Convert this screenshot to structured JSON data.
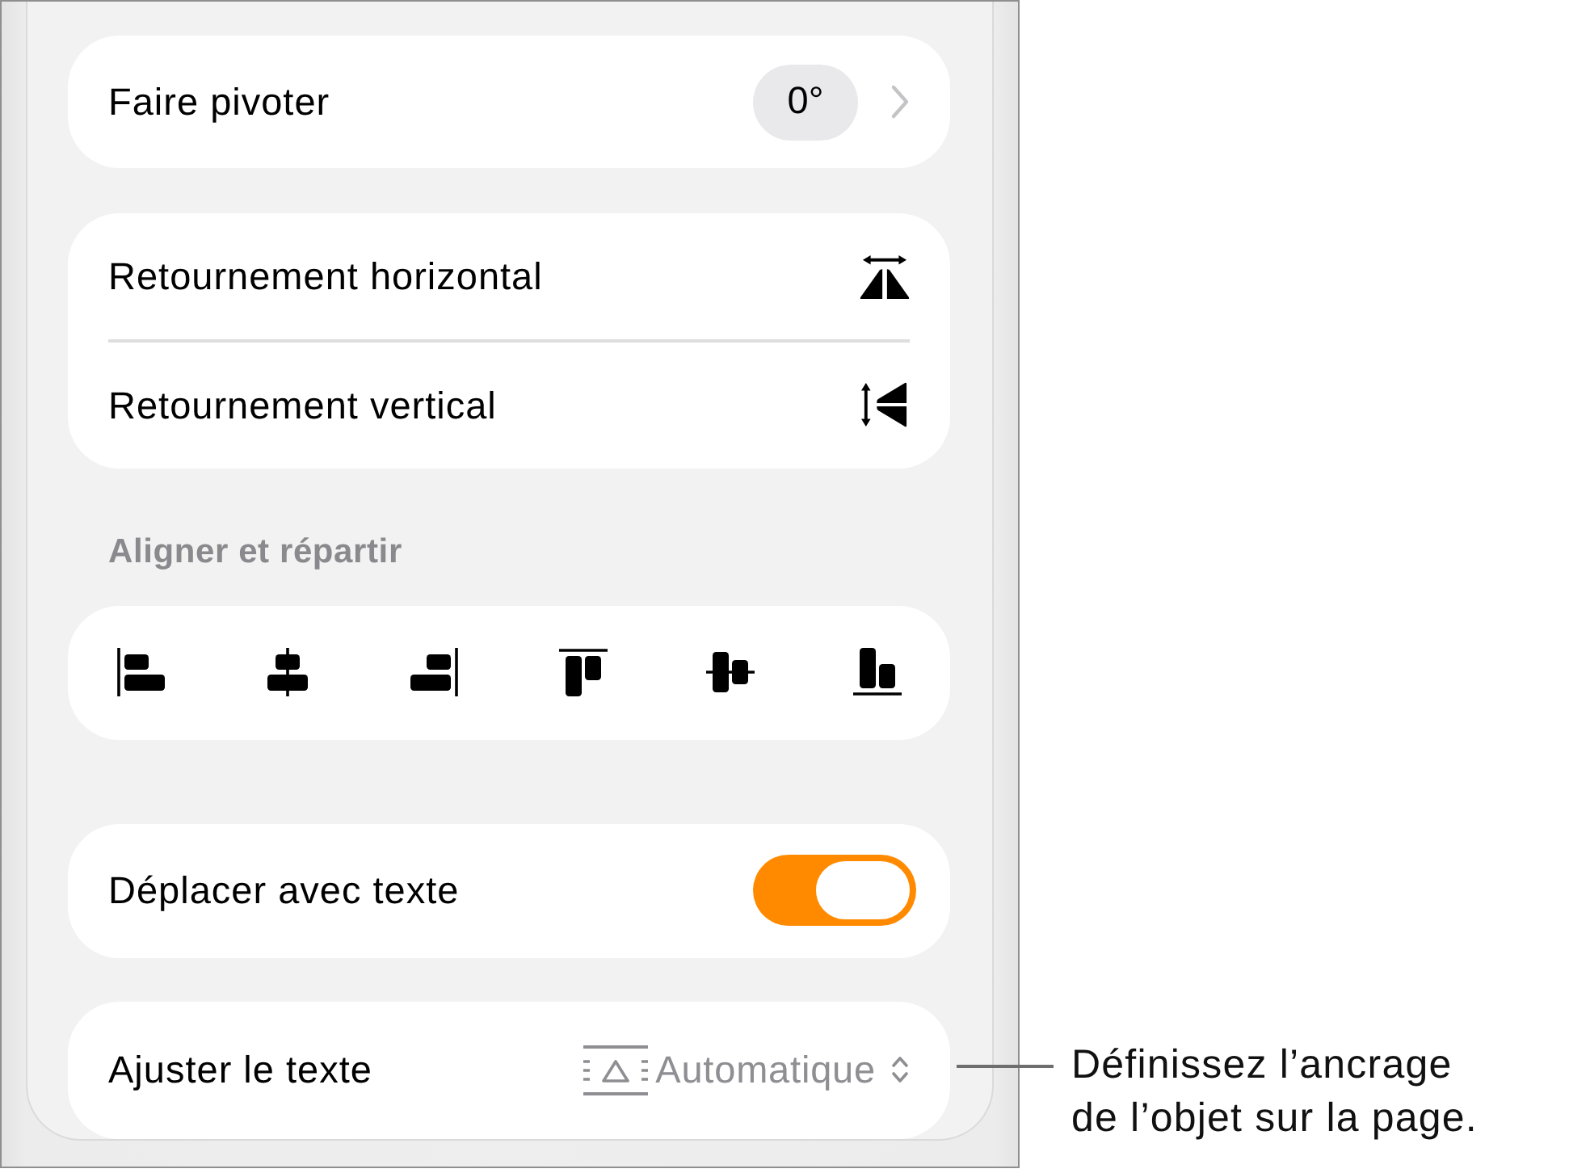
{
  "rotate": {
    "label": "Faire pivoter",
    "value": "0°"
  },
  "flip": [
    {
      "label": "Retournement horizontal",
      "kind": "horizontal"
    },
    {
      "label": "Retournement vertical",
      "kind": "vertical"
    }
  ],
  "align": {
    "heading": "Aligner et répartir",
    "buttons": [
      {
        "kind": "left"
      },
      {
        "kind": "center"
      },
      {
        "kind": "right"
      },
      {
        "kind": "top"
      },
      {
        "kind": "middle"
      },
      {
        "kind": "bottom"
      }
    ]
  },
  "move_with_text": {
    "label": "Déplacer avec texte",
    "on": true
  },
  "wrap_text": {
    "label": "Ajuster le texte",
    "value": "Automatique"
  },
  "callout": {
    "text": "Définissez l’ancrage de l’objet sur la page."
  }
}
